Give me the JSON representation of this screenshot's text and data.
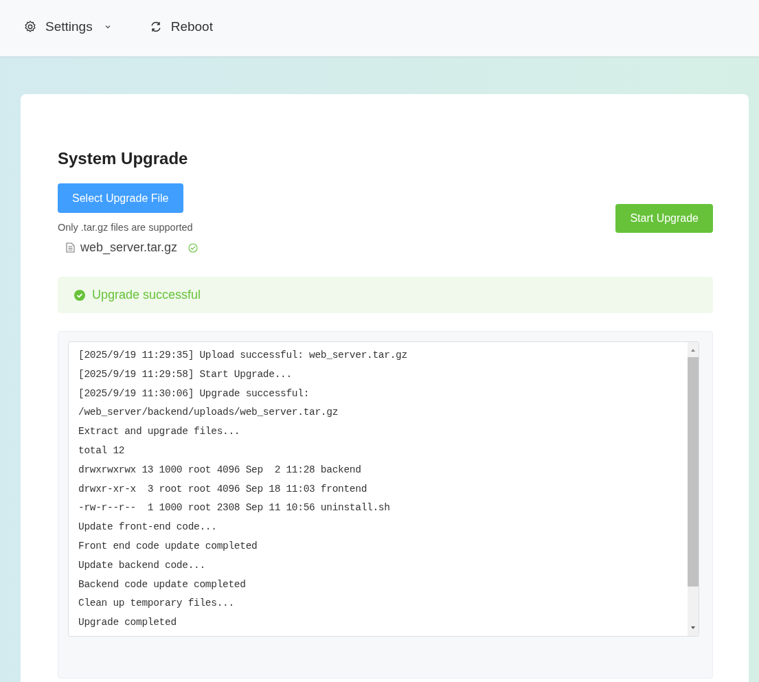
{
  "header": {
    "menu": [
      {
        "kind": "settings",
        "label": "Settings"
      },
      {
        "kind": "reboot",
        "label": "Reboot"
      }
    ]
  },
  "card": {
    "title": "System Upgrade",
    "select_button": "Select Upgrade File",
    "hint": "Only .tar.gz files are supported",
    "file": {
      "name": "web_server.tar.gz",
      "uploaded": true
    },
    "start_button": "Start Upgrade",
    "alert": {
      "success": true,
      "message": "Upgrade successful"
    },
    "log": [
      "[2025/9/19 11:29:35] Upload successful: web_server.tar.gz",
      "[2025/9/19 11:29:58] Start Upgrade...",
      "[2025/9/19 11:30:06] Upgrade successful:",
      "/web_server/backend/uploads/web_server.tar.gz",
      "Extract and upgrade files...",
      "total 12",
      "drwxrwxrwx 13 1000 root 4096 Sep  2 11:28 backend",
      "drwxr-xr-x  3 root root 4096 Sep 18 11:03 frontend",
      "-rw-r--r--  1 1000 root 2308 Sep 11 10:56 uninstall.sh",
      "Update front-end code...",
      "Front end code update completed",
      "Update backend code...",
      "Backend code update completed",
      "Clean up temporary files...",
      "Upgrade completed"
    ]
  }
}
